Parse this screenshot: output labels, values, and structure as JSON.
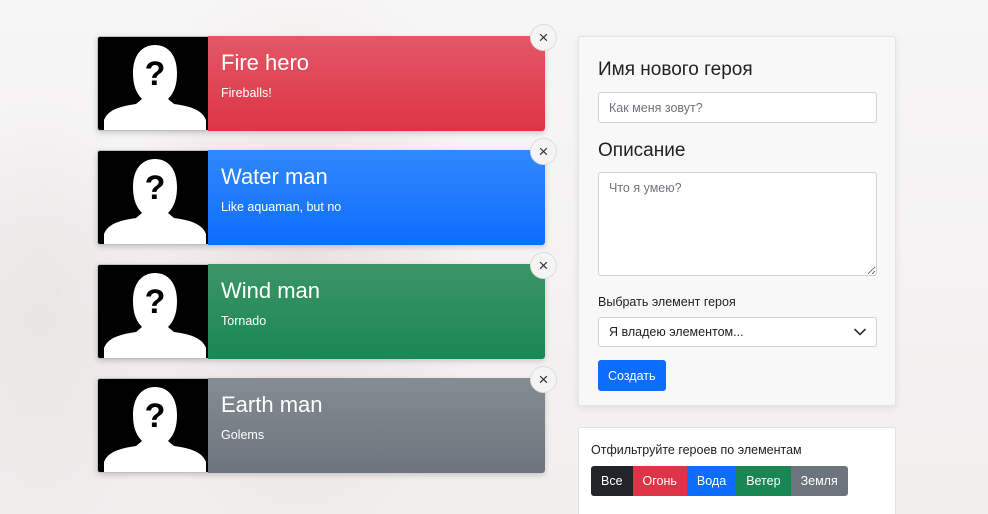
{
  "heroes": [
    {
      "name": "Fire hero",
      "description": "Fireballs!",
      "element": "fire",
      "color": "#dc3545"
    },
    {
      "name": "Water man",
      "description": "Like aquaman, but no",
      "element": "water",
      "color": "#0d6efd"
    },
    {
      "name": "Wind man",
      "description": "Tornado",
      "element": "wind",
      "color": "#198754"
    },
    {
      "name": "Earth man",
      "description": "Golems",
      "element": "earth",
      "color": "#6c757d"
    }
  ],
  "remove_icon": "×",
  "form": {
    "name_heading": "Имя нового героя",
    "name_placeholder": "Как меня зовут?",
    "desc_heading": "Описание",
    "desc_placeholder": "Что я умею?",
    "select_label": "Выбрать элемент героя",
    "select_value": "Я владею элементом...",
    "create_label": "Создать"
  },
  "filter": {
    "title": "Отфильтруйте героев по элементам",
    "buttons": [
      "Все",
      "Огонь",
      "Вода",
      "Ветер",
      "Земля"
    ]
  },
  "colors": {
    "fire": "#dc3545",
    "water": "#0d6efd",
    "wind": "#198754",
    "earth": "#6c757d",
    "all": "#212529",
    "primary": "#0d6efd"
  }
}
